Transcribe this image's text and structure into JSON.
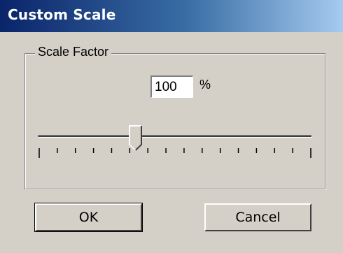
{
  "dialog": {
    "title": "Custom Scale",
    "group_label": "Scale Factor",
    "scale_value": "100",
    "unit": "%",
    "slider_fraction": 0.35,
    "tick_count": 16,
    "ok_label": "OK",
    "cancel_label": "Cancel"
  },
  "colors": {
    "titlebar_start": "#0a246a",
    "titlebar_end": "#a6caf0",
    "face": "#d4d0c8"
  }
}
